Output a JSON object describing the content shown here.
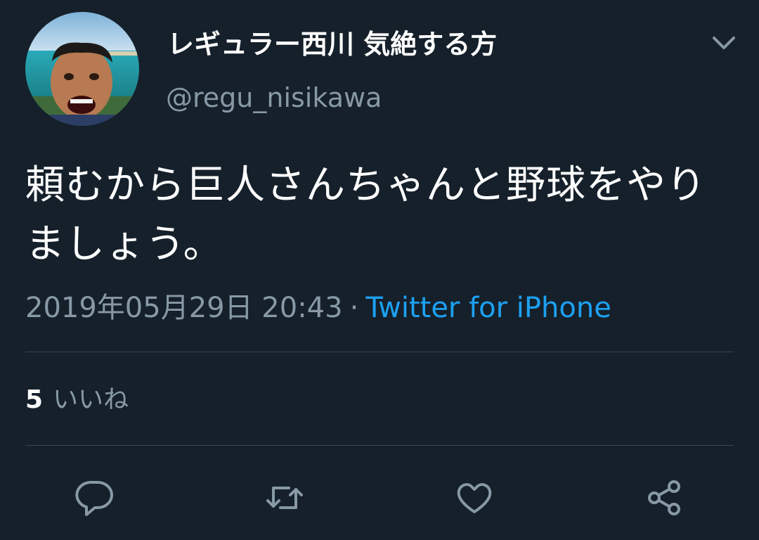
{
  "user": {
    "display_name": "レギュラー西川 気絶する方",
    "handle": "@regu_nisikawa",
    "avatar_icon": "profile-photo"
  },
  "tweet": {
    "text": "頼むから巨人さんちゃんと野球をやりましょう。",
    "timestamp": "2019年05月29日 20:43",
    "separator": "·",
    "source": "Twitter for iPhone"
  },
  "stats": {
    "likes_count": "5",
    "likes_label": "いいね"
  },
  "actions": [
    {
      "name": "reply",
      "icon": "speech-bubble-icon"
    },
    {
      "name": "retweet",
      "icon": "retweet-icon"
    },
    {
      "name": "like",
      "icon": "heart-icon"
    },
    {
      "name": "share",
      "icon": "share-icon"
    }
  ],
  "colors": {
    "background": "#15202b",
    "text_primary": "#ffffff",
    "text_secondary": "#8899a6",
    "accent": "#1da1f2",
    "divider": "#38444d"
  }
}
